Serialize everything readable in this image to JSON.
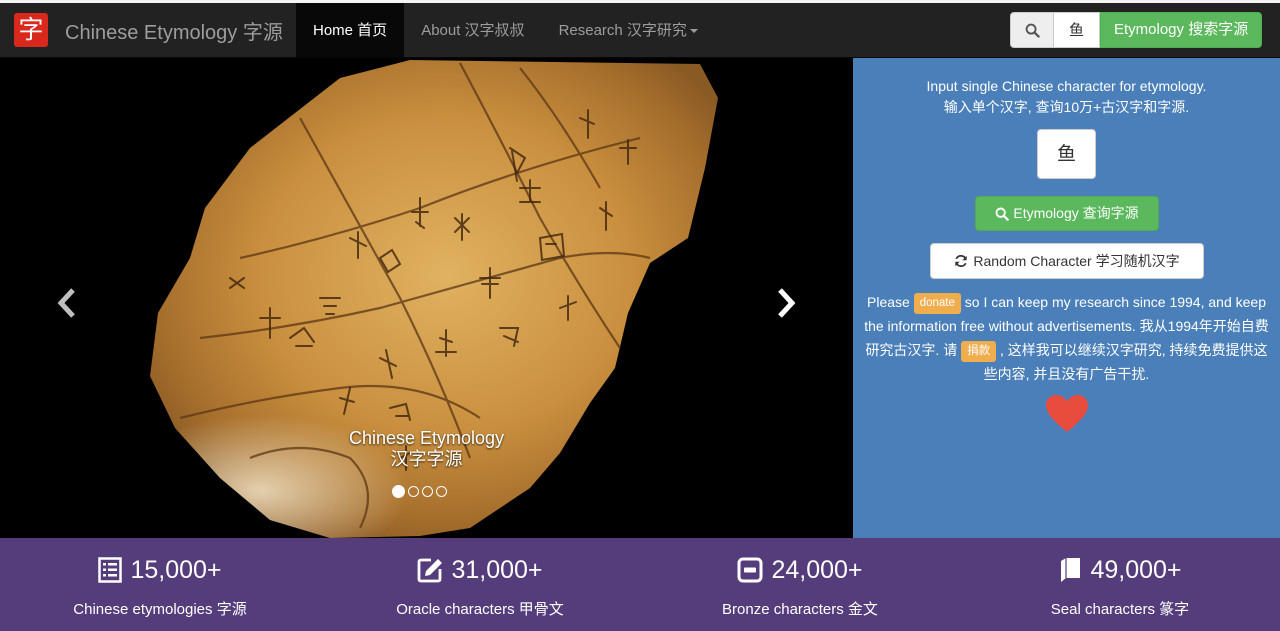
{
  "navbar": {
    "logo_char": "字",
    "brand": "Chinese Etymology 字源",
    "items": [
      {
        "label": "Home 首页",
        "active": true
      },
      {
        "label": "About 汉字叔叔",
        "active": false
      },
      {
        "label": "Research 汉字研究",
        "active": false,
        "dropdown": true
      }
    ],
    "search_icon": "search-icon",
    "search_value": "鱼",
    "search_button": "Etymology 搜索字源"
  },
  "carousel": {
    "caption_line1": "Chinese Etymology",
    "caption_line2": "汉字字源",
    "slide_count": 4,
    "active_slide": 1,
    "prev_icon": "chevron-left-icon",
    "next_icon": "chevron-right-icon"
  },
  "panel": {
    "intro_en": "Input single Chinese character for etymology.",
    "intro_zh": "输入单个汉字, 查询10万+古汉字和字源.",
    "char_value": "鱼",
    "etymology_button": "Etymology 查询字源",
    "random_button": "Random Character 学习随机汉字",
    "donate_prefix": "Please",
    "donate_label": "donate",
    "donate_suffix": "so I can keep my research since 1994, and keep the information free without advertisements.",
    "donate_zh_prefix": "我从1994年开始自费研究古汉字. 请",
    "donate_zh_label": "捐款",
    "donate_zh_suffix": ", 这样我可以继续汉字研究, 持续免费提供这些内容, 并且没有广告干扰.",
    "heart_icon": "heart-icon"
  },
  "stats": [
    {
      "icon": "list-icon",
      "value": "15,000+",
      "label": "Chinese etymologies 字源"
    },
    {
      "icon": "edit-icon",
      "value": "31,000+",
      "label": "Oracle characters 甲骨文"
    },
    {
      "icon": "square-icon",
      "value": "24,000+",
      "label": "Bronze characters 金文"
    },
    {
      "icon": "book-icon",
      "value": "49,000+",
      "label": "Seal characters 篆字"
    }
  ],
  "colors": {
    "navbar_bg": "#222222",
    "panel_bg": "#4a7fba",
    "stats_bg": "#553d7c",
    "success": "#5cb85c",
    "warning": "#f0ad4e",
    "heart": "#e74c3c",
    "logo": "#d9291c"
  }
}
